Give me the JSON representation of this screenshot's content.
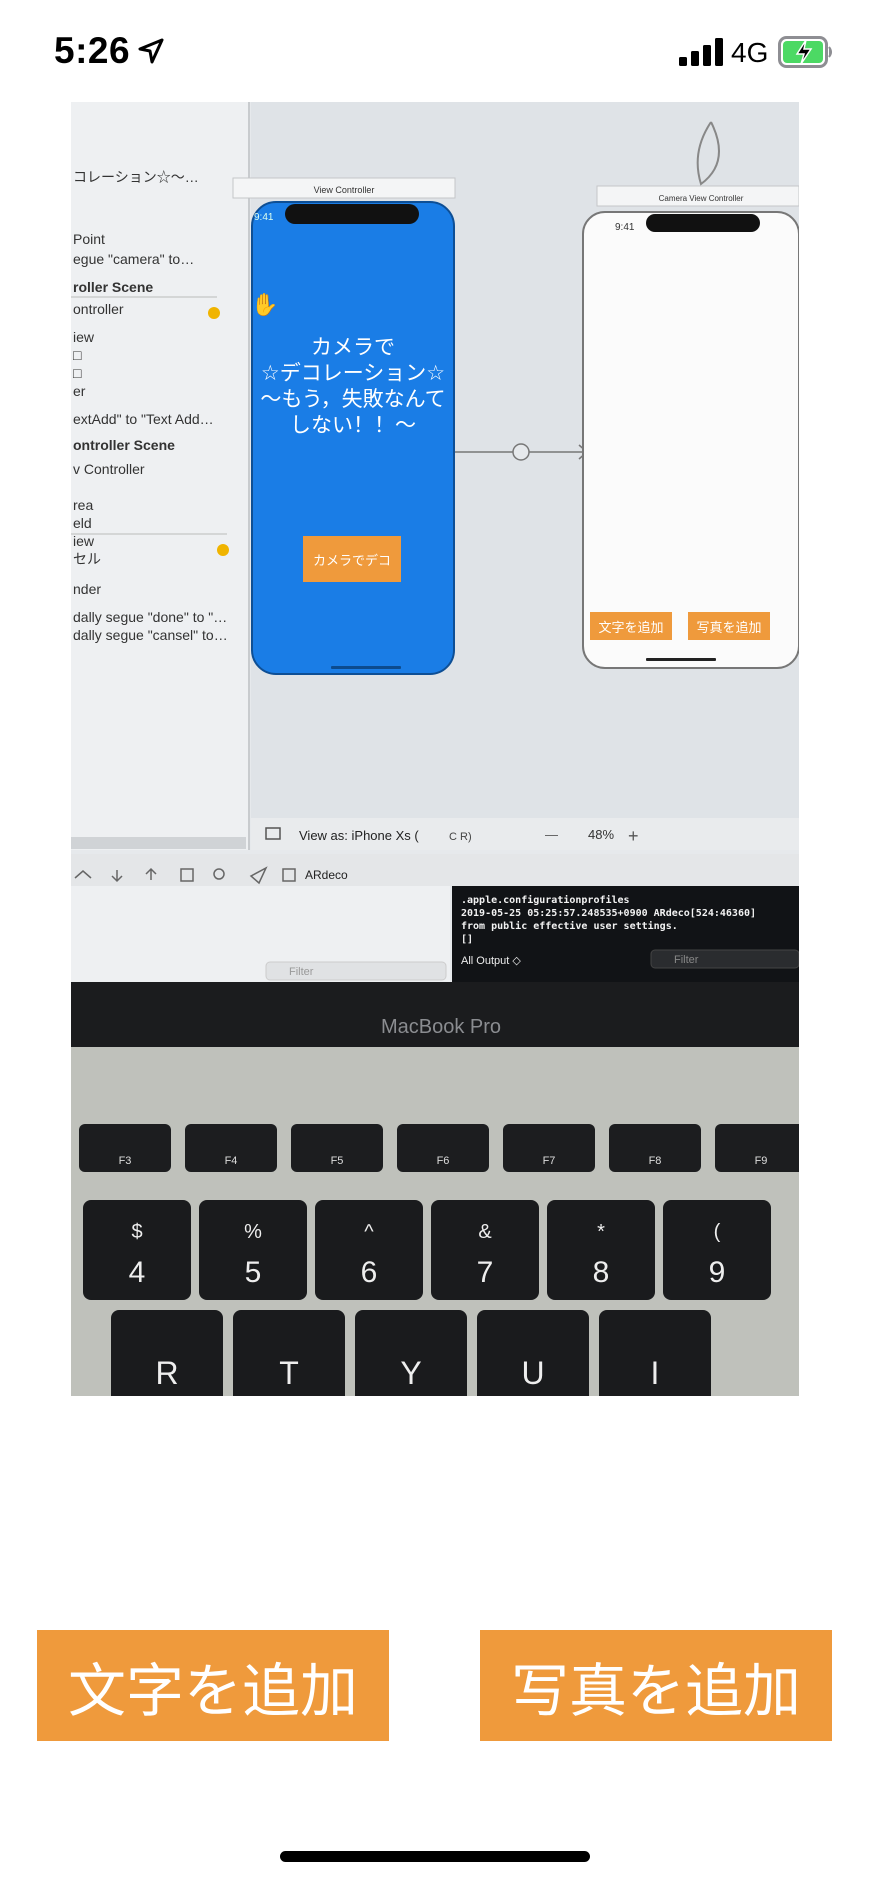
{
  "status_bar": {
    "time": "5:26",
    "carrier": "4G",
    "icons": [
      "location-arrow-icon",
      "signal-icon",
      "battery-charging-icon"
    ]
  },
  "photo": {
    "description_icons": [
      "photo-preview"
    ],
    "xcode": {
      "outline_items": [
        "コレーション☆〜…",
        "Point",
        "egue \"camera\" to…",
        "roller Scene",
        "ontroller",
        "iew",
        "□",
        "□",
        "er",
        "extAdd\" to \"Text Add…",
        "ontroller Scene",
        "v Controller",
        "rea",
        "eld",
        "iew",
        "セル",
        "nder",
        "dally segue \"done\" to \"…",
        "dally segue \"cansel\" to…"
      ],
      "view_controller_title": "View Controller",
      "camera_vc_title": "Camera View Controller",
      "phone_time": "9:41",
      "main_label_lines": [
        "カメラで",
        "☆デコレーション☆",
        "〜もう，失敗なんて",
        "しない！！〜"
      ],
      "camera_button": "カメラでデコ",
      "small_text_button": "文字を追加",
      "small_photo_button": "写真を追加",
      "view_as": "View as: iPhone Xs (",
      "view_as_suffix": "C  R)",
      "zoom": "48%",
      "zoom_minus": "—",
      "zoom_plus": "+",
      "project_name": "ARdeco",
      "console_lines": [
        ".apple.configurationprofiles",
        "2019-05-25 05:25:57.248535+0900 ARdeco[524:46360]",
        "  from public effective user settings.",
        "[]"
      ],
      "filter_placeholder": "Filter",
      "all_output": "All Output ◇"
    },
    "macbook_label": "MacBook Pro",
    "fn_keys": [
      "F3",
      "F4",
      "F5",
      "F6",
      "F7",
      "F8",
      "F9"
    ],
    "number_keys": [
      {
        "top": "$",
        "bottom": "4"
      },
      {
        "top": "%",
        "bottom": "5"
      },
      {
        "top": "^",
        "bottom": "6"
      },
      {
        "top": "&",
        "bottom": "7"
      },
      {
        "top": "*",
        "bottom": "8"
      },
      {
        "top": "(",
        "bottom": "9"
      }
    ],
    "letter_keys": [
      "R",
      "T",
      "Y",
      "U",
      "I"
    ]
  },
  "actions": {
    "add_text": "文字を追加",
    "add_photo": "写真を追加"
  },
  "colors": {
    "accent": "#ef9a3c",
    "scene_blue": "#1a7de6"
  }
}
